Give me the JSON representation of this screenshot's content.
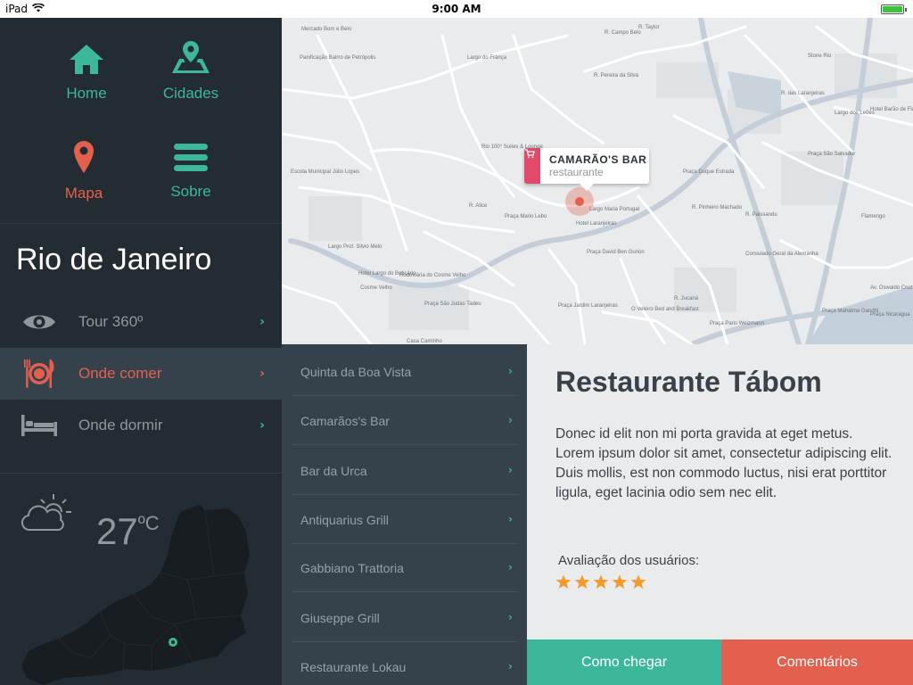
{
  "statusbar": {
    "device": "iPad",
    "time": "9:00 AM",
    "battery_level": 1.0
  },
  "nav": [
    {
      "label": "Home",
      "icon": "home-icon",
      "color": "#3cb79a"
    },
    {
      "label": "Cidades",
      "icon": "map-icon",
      "color": "#3cb79a"
    },
    {
      "label": "Mapa",
      "icon": "map-pin-icon",
      "color": "#e4604e"
    },
    {
      "label": "Sobre",
      "icon": "menu-icon",
      "color": "#3cb79a"
    }
  ],
  "city": "Rio de Janeiro",
  "menu": [
    {
      "label": "Tour 360º",
      "icon": "eye-icon",
      "active": false
    },
    {
      "label": "Onde comer",
      "icon": "restaurant-icon",
      "active": true
    },
    {
      "label": "Onde dormir",
      "icon": "bed-icon",
      "active": false
    }
  ],
  "weather": {
    "icon": "partly-cloudy-icon",
    "temperature": "27",
    "unit": "ºC"
  },
  "map": {
    "callout_title": "CAMARÃO'S BAR",
    "callout_subtitle": "restaurante",
    "labels": [
      "Largo do França",
      "R. Campo Belo",
      "R. Taylor",
      "Mercado Bom e Belo",
      "Panificação Bairro de Petrópolis",
      "R. Pereira da Silva",
      "R. das Laranjeiras",
      "Rio 100° Suites & Lounge",
      "Escola Municipal Júlio Lopes",
      "R. Alice",
      "Praça Mario Lebo",
      "Largo Maria Portugal",
      "Praça David Ben Gurion",
      "Largo Prof. Silvio Melo",
      "Rodoviária do Cosme Velho",
      "Praça São Judas Tadeu",
      "Casa Caminho",
      "R. Jucaná",
      "O Veleiro Bed and Breakfast",
      "Praça Jardim Laranjeiras",
      "R. Paissandu",
      "Flamengo",
      "Consulado Geral da Alemanha",
      "Hotel Barão de Flamengo",
      "Praça Mahatma Gandhi",
      "Praça Nicaragua",
      "Largo dos Leões",
      "Praça São Salvador",
      "Hotel Largo do Boticário",
      "Cosme Velho",
      "R. Pinheiro Machado",
      "Av. Oswaldo Cruz",
      "Stone Rio",
      "Praça Duque Estrada",
      "Praça Paris Weizmann",
      "Hotel Laranjeiras"
    ]
  },
  "restaurants": [
    "Quinta da Boa Vista",
    "Camarãos's Bar",
    "Bar da Urca",
    "Antiquarius Grill",
    "Gabbiano Trattoria",
    "Giuseppe Grill",
    "Restaurante Lokau"
  ],
  "detail": {
    "title": "Restaurante Tábom",
    "description": "Donec id elit non mi porta gravida at eget metus. Lorem ipsum dolor sit amet, consectetur adipiscing elit. Duis mollis, est non commodo luctus, nisi erat porttitor ligula, eget lacinia odio sem nec elit.",
    "rating_label": "Avaliação dos usuários:",
    "rating": 5,
    "rating_max": 5,
    "directions_button": "Como chegar",
    "comments_button": "Comentários"
  },
  "colors": {
    "accent_teal": "#3cb79a",
    "accent_red": "#e4604e",
    "sidebar_bg": "#242c33",
    "panel_bg": "#36424b",
    "star": "#f39a2b"
  }
}
